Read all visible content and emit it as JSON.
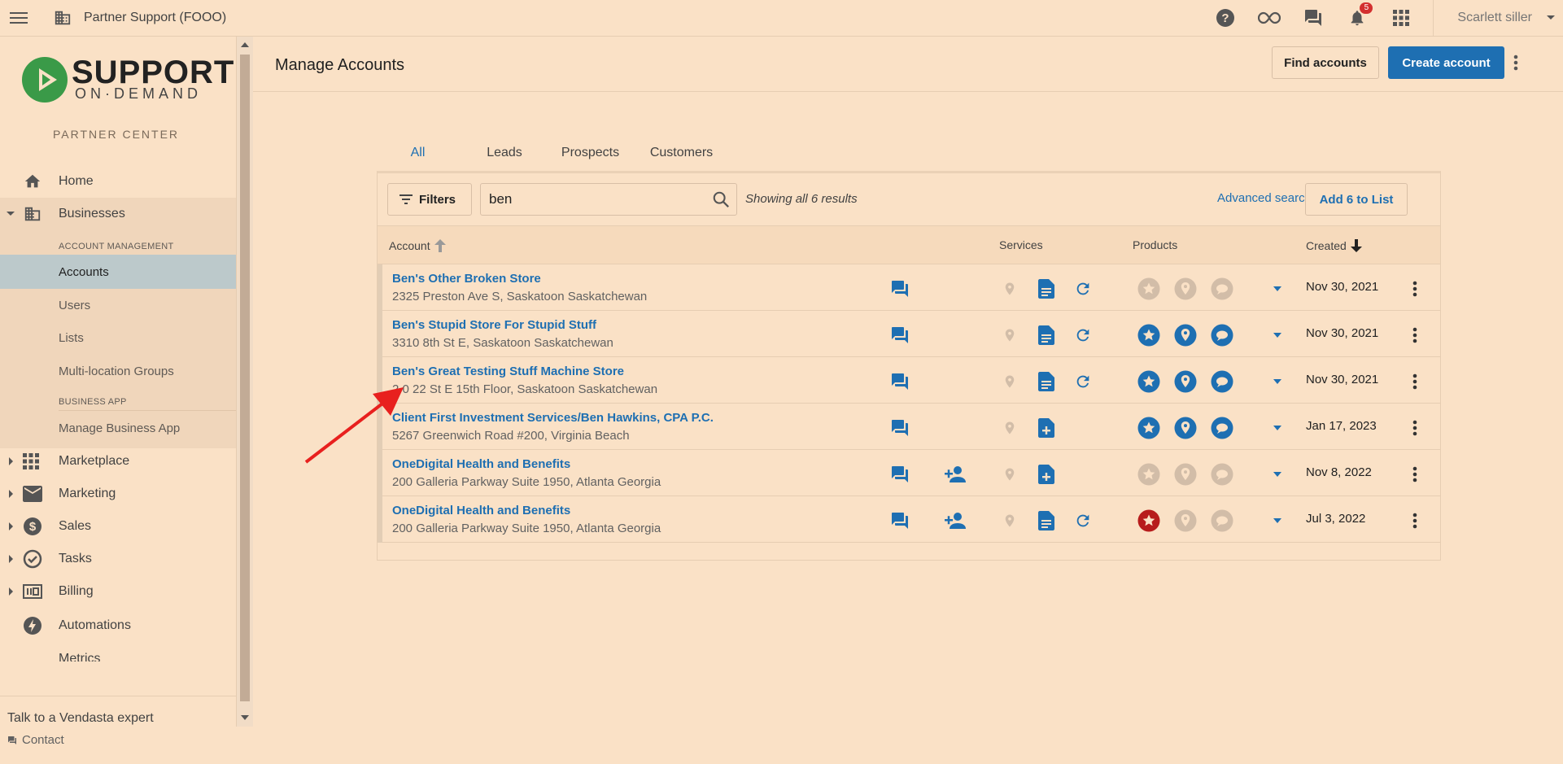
{
  "topbar": {
    "partner_name": "Partner Support (FOOO)",
    "notifications_count": "5",
    "user_name": "Scarlett siller",
    "icons": [
      "menu-icon",
      "building-icon",
      "help-icon",
      "infinity-icon",
      "chat-icon",
      "bell-icon",
      "apps-grid-icon",
      "caret-down-icon"
    ]
  },
  "sidebar": {
    "logo_line1": "SUPPORT",
    "logo_line2": "ON·DEMAND",
    "partner_center": "PARTNER CENTER",
    "items": {
      "home": "Home",
      "businesses": "Businesses",
      "section_account_management": "ACCOUNT MANAGEMENT",
      "accounts": "Accounts",
      "users": "Users",
      "lists": "Lists",
      "multi_location": "Multi-location Groups",
      "section_business_app": "BUSINESS APP",
      "manage_business_app": "Manage Business App",
      "marketplace": "Marketplace",
      "marketing": "Marketing",
      "sales": "Sales",
      "tasks": "Tasks",
      "billing": "Billing",
      "automations": "Automations",
      "metrics": "Metrics"
    },
    "footer_talk": "Talk to a Vendasta expert",
    "footer_contact": "Contact"
  },
  "main": {
    "title": "Manage Accounts",
    "find_accounts": "Find accounts",
    "create_account": "Create account",
    "tabs": [
      "All",
      "Leads",
      "Prospects",
      "Customers"
    ],
    "filters_label": "Filters",
    "search_value": "ben",
    "results_text": "Showing all 6 results",
    "advanced_search": "Advanced search",
    "add_to_list": "Add 6 to List",
    "columns": {
      "account": "Account",
      "services": "Services",
      "products": "Products",
      "created": "Created"
    }
  },
  "colors": {
    "accent": "#1e6fb2",
    "background": "#fae1c6",
    "inactive_icon": "#d2bda8",
    "red_badge": "#b71c1c",
    "arrow": "#e8201e"
  },
  "rows": [
    {
      "name": "Ben's Other Broken Store",
      "address": "2325 Preston Ave S, Saskatoon Saskatchewan",
      "date": "Nov 30, 2021"
    },
    {
      "name": "Ben's Stupid Store For Stupid Stuff",
      "address": "3310 8th St E, Saskatoon Saskatchewan",
      "date": "Nov 30, 2021"
    },
    {
      "name": "Ben's Great Testing Stuff Machine Store",
      "address": "2 0 22 St E 15th Floor, Saskatoon Saskatchewan",
      "date": "Nov 30, 2021"
    },
    {
      "name": "Client First Investment Services/Ben Hawkins, CPA P.C.",
      "address": "5267 Greenwich Road #200, Virginia Beach",
      "date": "Jan 17, 2023"
    },
    {
      "name": "OneDigital Health and Benefits",
      "address": "200 Galleria Parkway Suite 1950, Atlanta Georgia",
      "date": "Nov 8, 2022"
    },
    {
      "name": "OneDigital Health and Benefits",
      "address": "200 Galleria Parkway Suite 1950, Atlanta Georgia",
      "date": "Jul 3, 2022"
    }
  ]
}
